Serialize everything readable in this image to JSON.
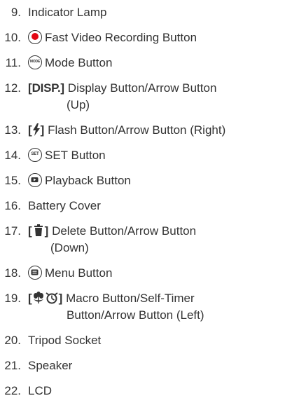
{
  "items": [
    {
      "num": "9.",
      "label": "Indicator Lamp"
    },
    {
      "num": "10.",
      "label": "Fast Video Recording Button",
      "icon": "record-icon"
    },
    {
      "num": "11.",
      "label": "Mode Button",
      "icon": "mode-icon",
      "icon_text": "MODE"
    },
    {
      "num": "12.",
      "bracket_open": "[",
      "icon_text": "DISP.",
      "bracket_close": "]",
      "label": "Display Button/Arrow Button",
      "label_cont": "(Up)"
    },
    {
      "num": "13.",
      "bracket_open": "[",
      "icon": "flash-icon",
      "bracket_close": "]",
      "label": "Flash Button/Arrow Button (Right)"
    },
    {
      "num": "14.",
      "label": "SET Button",
      "icon": "set-icon",
      "icon_text": "SET"
    },
    {
      "num": "15.",
      "label": "Playback Button",
      "icon": "playback-icon"
    },
    {
      "num": "16.",
      "label": "Battery Cover"
    },
    {
      "num": "17.",
      "bracket_open": "[",
      "icon": "trash-icon",
      "bracket_close": "]",
      "label": "Delete Button/Arrow Button",
      "label_cont": "(Down)"
    },
    {
      "num": "18.",
      "label": "Menu Button",
      "icon": "menu-icon"
    },
    {
      "num": "19.",
      "bracket_open": "[",
      "icon": "macro-timer-icon",
      "bracket_close": "]",
      "label": "Macro Button/Self-Timer",
      "label_cont": "Button/Arrow Button (Left)"
    },
    {
      "num": "20.",
      "label": "Tripod Socket"
    },
    {
      "num": "21.",
      "label": "Speaker"
    },
    {
      "num": "22.",
      "label": "LCD"
    }
  ]
}
